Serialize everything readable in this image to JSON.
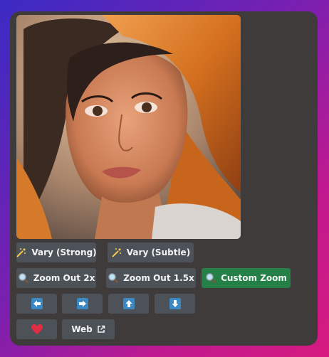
{
  "buttons": {
    "vary_strong": "Vary (Strong)",
    "vary_subtle": "Vary (Subtle)",
    "zoom_out_2x": "Zoom Out 2x",
    "zoom_out_1_5x": "Zoom Out 1.5x",
    "custom_zoom": "Custom Zoom",
    "web": "Web"
  },
  "icons": {
    "vary": "magic-wand-sparkle-icon",
    "zoom": "magnifying-glass-icon",
    "pan_left": "arrow-left-icon",
    "pan_right": "arrow-right-icon",
    "pan_up": "arrow-up-icon",
    "pan_down": "arrow-down-icon",
    "favorite": "heart-icon",
    "external": "external-link-icon"
  },
  "colors": {
    "card_bg": "#3f3b3a",
    "button_bg": "#4d5158",
    "accent_green": "#248046",
    "arrow_blue": "#3b88c3",
    "heart_red": "#dd2e44"
  }
}
